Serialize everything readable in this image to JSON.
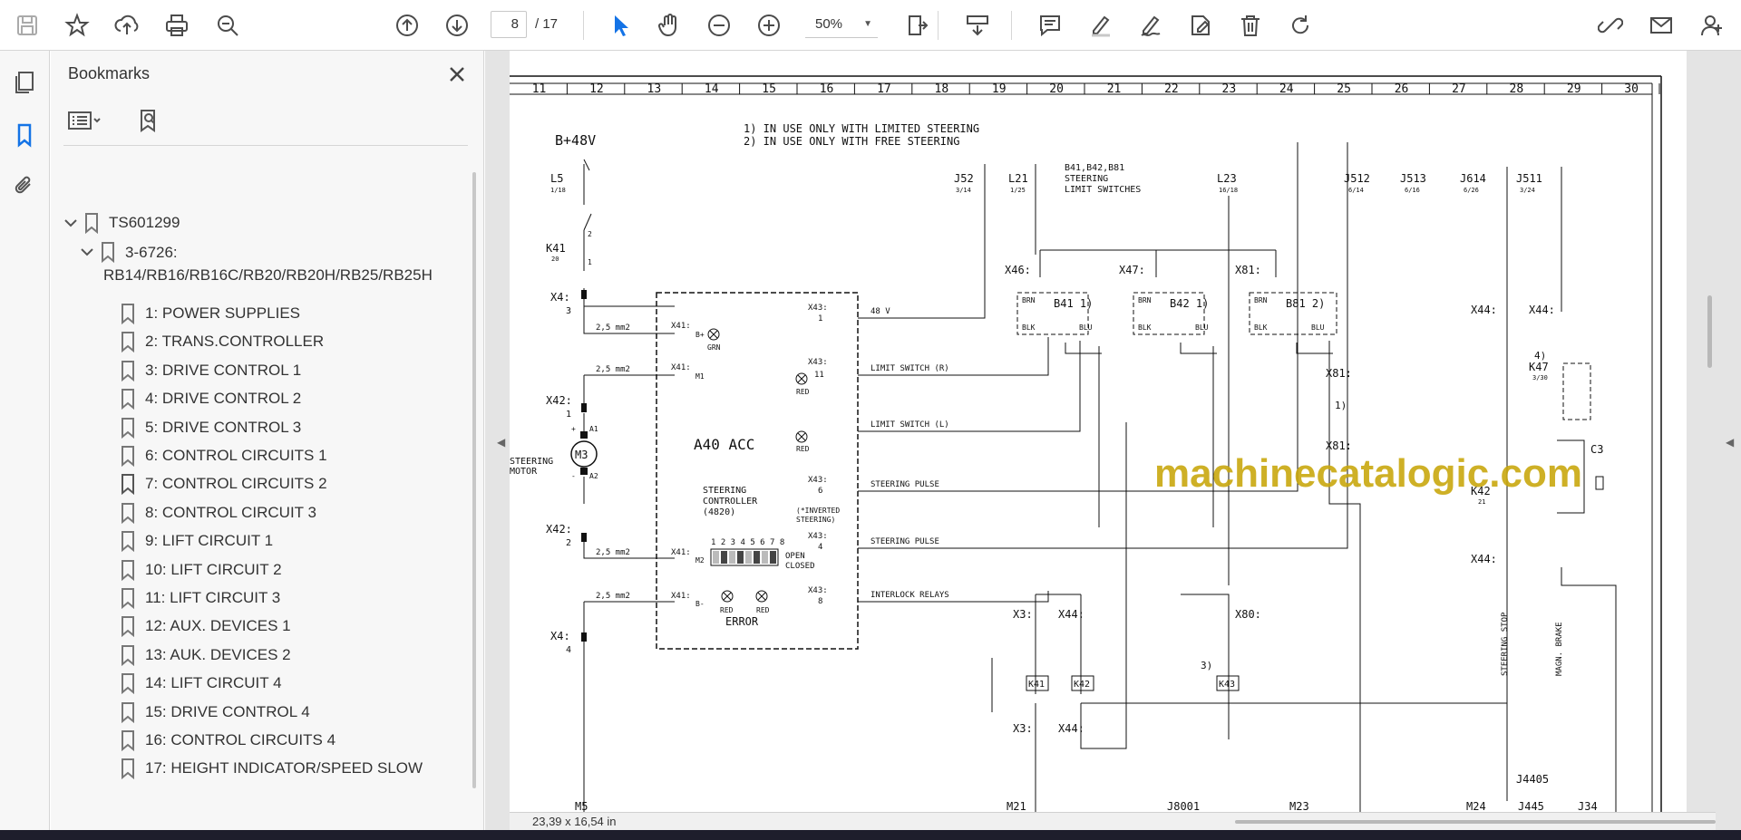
{
  "toolbar": {
    "page_current": "8",
    "page_total": "/ 17",
    "zoom": "50%",
    "icons": [
      "save-icon",
      "star-icon",
      "upload-icon",
      "print-icon",
      "find-icon",
      "page-up-icon",
      "page-down-icon",
      "pointer-icon",
      "hand-icon",
      "zoom-out-icon",
      "zoom-in-icon",
      "fit-page-icon",
      "scroll-mode-icon",
      "comment-icon",
      "highlight-icon",
      "sign-icon",
      "stamp-icon",
      "delete-icon",
      "rotate-icon",
      "share-link-icon",
      "mail-icon",
      "account-icon"
    ]
  },
  "bookmarks": {
    "title": "Bookmarks",
    "root": "TS601299",
    "parent_line1": "3-6726:",
    "parent_line2": "RB14/RB16/RB16C/RB20/RB20H/RB25/RB25H",
    "items": [
      "1: POWER SUPPLIES",
      "2: TRANS.CONTROLLER",
      "3: DRIVE CONTROL 1",
      "4: DRIVE CONTROL 2",
      "5: DRIVE CONTROL 3",
      "6: CONTROL CIRCUITS 1",
      "7: CONTROL CIRCUITS 2",
      "8: CONTROL CIRCUIT 3",
      "9: LIFT CIRCUIT 1",
      "10: LIFT CIRCUIT 2",
      "11: LIFT CIRCUIT 3",
      "12: AUX. DEVICES 1",
      "13: AUK. DEVICES 2",
      "14: LIFT CIRCUIT 4",
      "15: DRIVE CONTROL 4",
      "16: CONTROL CIRCUITS 4",
      "17: HEIGHT INDICATOR/SPEED SLOW"
    ]
  },
  "status": {
    "page_size": "23,39 x 16,54 in"
  },
  "watermark": "machinecatalogic.com",
  "schematic": {
    "columns": [
      "11",
      "12",
      "13",
      "14",
      "15",
      "16",
      "17",
      "18",
      "19",
      "20",
      "21",
      "22",
      "23",
      "24",
      "25",
      "26",
      "27",
      "28",
      "29",
      "30"
    ],
    "note1": "1) IN USE ONLY WITH LIMITED STEERING",
    "note2": "2) IN USE ONLY WITH FREE STEERING",
    "supply": "B+48V",
    "limit_switch_title": "B41,B42,B81",
    "limit_switch_sub1": "STEERING",
    "limit_switch_sub2": "LIMIT SWITCHES",
    "controller_name": "A40 ACC",
    "controller_desc1": "STEERING",
    "controller_desc2": "CONTROLLER",
    "controller_desc3": "(4820)",
    "motor": "M3",
    "motor_label1": "STEERING",
    "motor_label2": "MOTOR",
    "wire_48v": "48 V",
    "wire_limit_r": "LIMIT SWITCH (R)",
    "wire_limit_l": "LIMIT SWITCH (L)",
    "wire_pulse1": "STEERING PULSE",
    "wire_pulse2": "STEERING PULSE",
    "wire_interlock": "INTERLOCK RELAYS",
    "inverted1": "(*INVERTED",
    "inverted2": "STEERING)",
    "error": "ERROR",
    "open": "OPEN",
    "closed": "CLOSED",
    "dip": "1 2 3 4 5 6 7 8",
    "green": "GRN",
    "red": "RED",
    "section_size": "2,5 mm2",
    "stop1": "STEERING STOP",
    "stop2": "MAGN. BRAKE",
    "bottom_labels": [
      "M5",
      "M21",
      "J8001",
      "M23",
      "M24",
      "J4405",
      "J445",
      "J34"
    ],
    "connectors": [
      "L5",
      "K41",
      "X4:",
      "X42:",
      "X42:",
      "X4:",
      "J52",
      "L21",
      "L23",
      "J512",
      "J513",
      "J614",
      "J511",
      "X46:",
      "X47:",
      "X81:",
      "X44:",
      "X44:",
      "K47",
      "K42",
      "C3",
      "X81:",
      "X81:",
      "X3:",
      "X44:",
      "X80:",
      "X3:",
      "X44:",
      "X44:",
      "K43"
    ],
    "switches": [
      "B41 1)",
      "B42 1)",
      "B81 2)"
    ]
  }
}
